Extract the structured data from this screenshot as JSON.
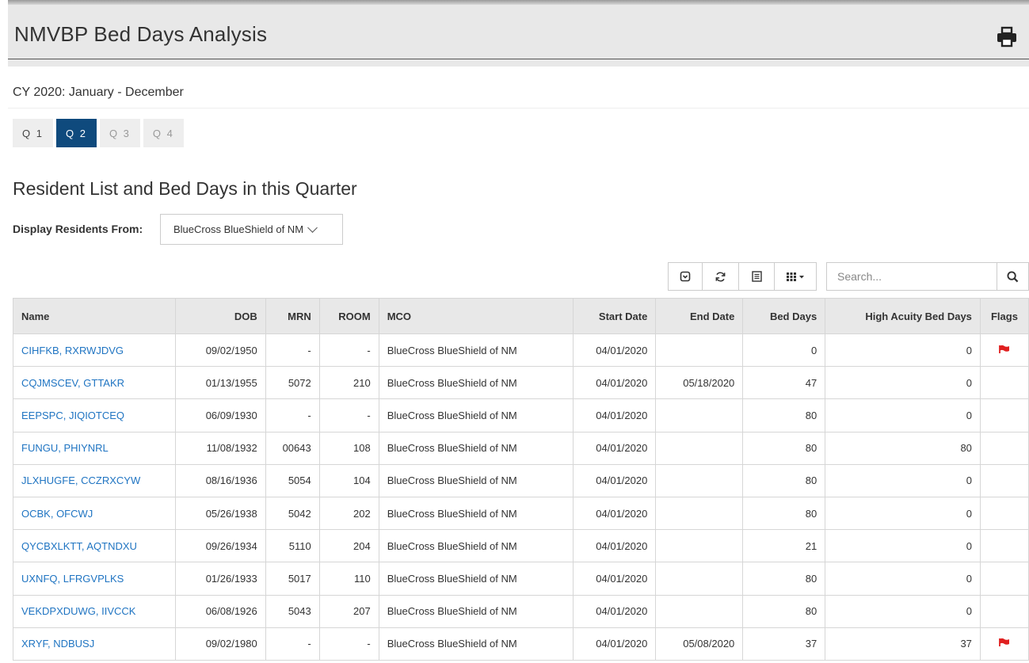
{
  "header": {
    "title": "NMVBP Bed Days Analysis",
    "print_icon": "print-icon"
  },
  "period": "CY 2020: January - December",
  "quarters": [
    {
      "label": "Q 1",
      "state": "enabled"
    },
    {
      "label": "Q 2",
      "state": "active"
    },
    {
      "label": "Q 3",
      "state": "disabled"
    },
    {
      "label": "Q 4",
      "state": "disabled"
    }
  ],
  "section_title": "Resident List and Bed Days in this Quarter",
  "filter": {
    "label": "Display Residents From:",
    "selected": "BlueCross BlueShield of NM"
  },
  "toolbar": {
    "icons": [
      "toggle-icon",
      "refresh-icon",
      "list-icon",
      "columns-grid-icon"
    ],
    "search_placeholder": "Search..."
  },
  "table": {
    "columns": [
      "Name",
      "DOB",
      "MRN",
      "ROOM",
      "MCO",
      "Start Date",
      "End Date",
      "Bed Days",
      "High Acuity Bed Days",
      "Flags"
    ],
    "rows": [
      {
        "name": "CIHFKB, RXRWJDVG",
        "dob": "09/02/1950",
        "mrn": "-",
        "room": "-",
        "mco": "BlueCross BlueShield of NM",
        "start": "04/01/2020",
        "end": "",
        "bed_days": "0",
        "high_acuity": "0",
        "flag": true
      },
      {
        "name": "CQJMSCEV, GTTAKR",
        "dob": "01/13/1955",
        "mrn": "5072",
        "room": "210",
        "mco": "BlueCross BlueShield of NM",
        "start": "04/01/2020",
        "end": "05/18/2020",
        "bed_days": "47",
        "high_acuity": "0",
        "flag": false
      },
      {
        "name": "EEPSPC, JIQIOTCEQ",
        "dob": "06/09/1930",
        "mrn": "-",
        "room": "-",
        "mco": "BlueCross BlueShield of NM",
        "start": "04/01/2020",
        "end": "",
        "bed_days": "80",
        "high_acuity": "0",
        "flag": false
      },
      {
        "name": "FUNGU, PHIYNRL",
        "dob": "11/08/1932",
        "mrn": "00643",
        "room": "108",
        "mco": "BlueCross BlueShield of NM",
        "start": "04/01/2020",
        "end": "",
        "bed_days": "80",
        "high_acuity": "80",
        "flag": false
      },
      {
        "name": "JLXHUGFE, CCZRXCYW",
        "dob": "08/16/1936",
        "mrn": "5054",
        "room": "104",
        "mco": "BlueCross BlueShield of NM",
        "start": "04/01/2020",
        "end": "",
        "bed_days": "80",
        "high_acuity": "0",
        "flag": false
      },
      {
        "name": "OCBK, OFCWJ",
        "dob": "05/26/1938",
        "mrn": "5042",
        "room": "202",
        "mco": "BlueCross BlueShield of NM",
        "start": "04/01/2020",
        "end": "",
        "bed_days": "80",
        "high_acuity": "0",
        "flag": false
      },
      {
        "name": "QYCBXLKTT, AQTNDXU",
        "dob": "09/26/1934",
        "mrn": "5110",
        "room": "204",
        "mco": "BlueCross BlueShield of NM",
        "start": "04/01/2020",
        "end": "",
        "bed_days": "21",
        "high_acuity": "0",
        "flag": false
      },
      {
        "name": "UXNFQ, LFRGVPLKS",
        "dob": "01/26/1933",
        "mrn": "5017",
        "room": "110",
        "mco": "BlueCross BlueShield of NM",
        "start": "04/01/2020",
        "end": "",
        "bed_days": "80",
        "high_acuity": "0",
        "flag": false
      },
      {
        "name": "VEKDPXDUWG, IIVCCK",
        "dob": "06/08/1926",
        "mrn": "5043",
        "room": "207",
        "mco": "BlueCross BlueShield of NM",
        "start": "04/01/2020",
        "end": "",
        "bed_days": "80",
        "high_acuity": "0",
        "flag": false
      },
      {
        "name": "XRYF, NDBUSJ",
        "dob": "09/02/1980",
        "mrn": "-",
        "room": "-",
        "mco": "BlueCross BlueShield of NM",
        "start": "04/01/2020",
        "end": "05/08/2020",
        "bed_days": "37",
        "high_acuity": "37",
        "flag": true
      }
    ]
  },
  "colors": {
    "active_tab": "#0f4a7d",
    "link": "#1f74c2",
    "flag": "#e02020",
    "header_bg": "#e8e8e8"
  }
}
